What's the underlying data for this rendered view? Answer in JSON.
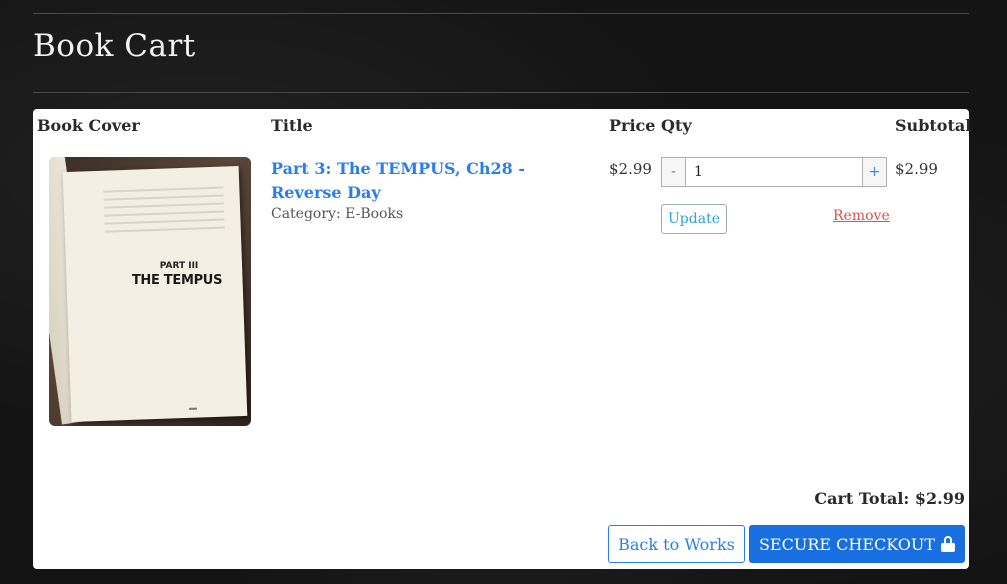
{
  "page": {
    "title": "Book Cart"
  },
  "table": {
    "headers": {
      "cover": "Book Cover",
      "title": "Title",
      "price": "Price",
      "qty": "Qty",
      "subtotal": "Subtotal"
    },
    "items": [
      {
        "title": "Part 3: The TEMPUS, Ch28 - Reverse Day",
        "category": "Category: E-Books",
        "price": "$2.99",
        "qty": "1",
        "subtotal": "$2.99",
        "cover_part": "PART III",
        "cover_title": "THE TEMPUS",
        "qty_minus": "-",
        "qty_plus": "+",
        "update_label": "Update",
        "remove_label": "Remove"
      }
    ]
  },
  "cart": {
    "total_text": "Cart Total: $2.99",
    "back_label": "Back to Works",
    "checkout_label": "SECURE CHECKOUT"
  },
  "colors": {
    "link": "#2b7de9",
    "remove": "#d9534f",
    "checkout_bg": "#1a6fe0"
  }
}
